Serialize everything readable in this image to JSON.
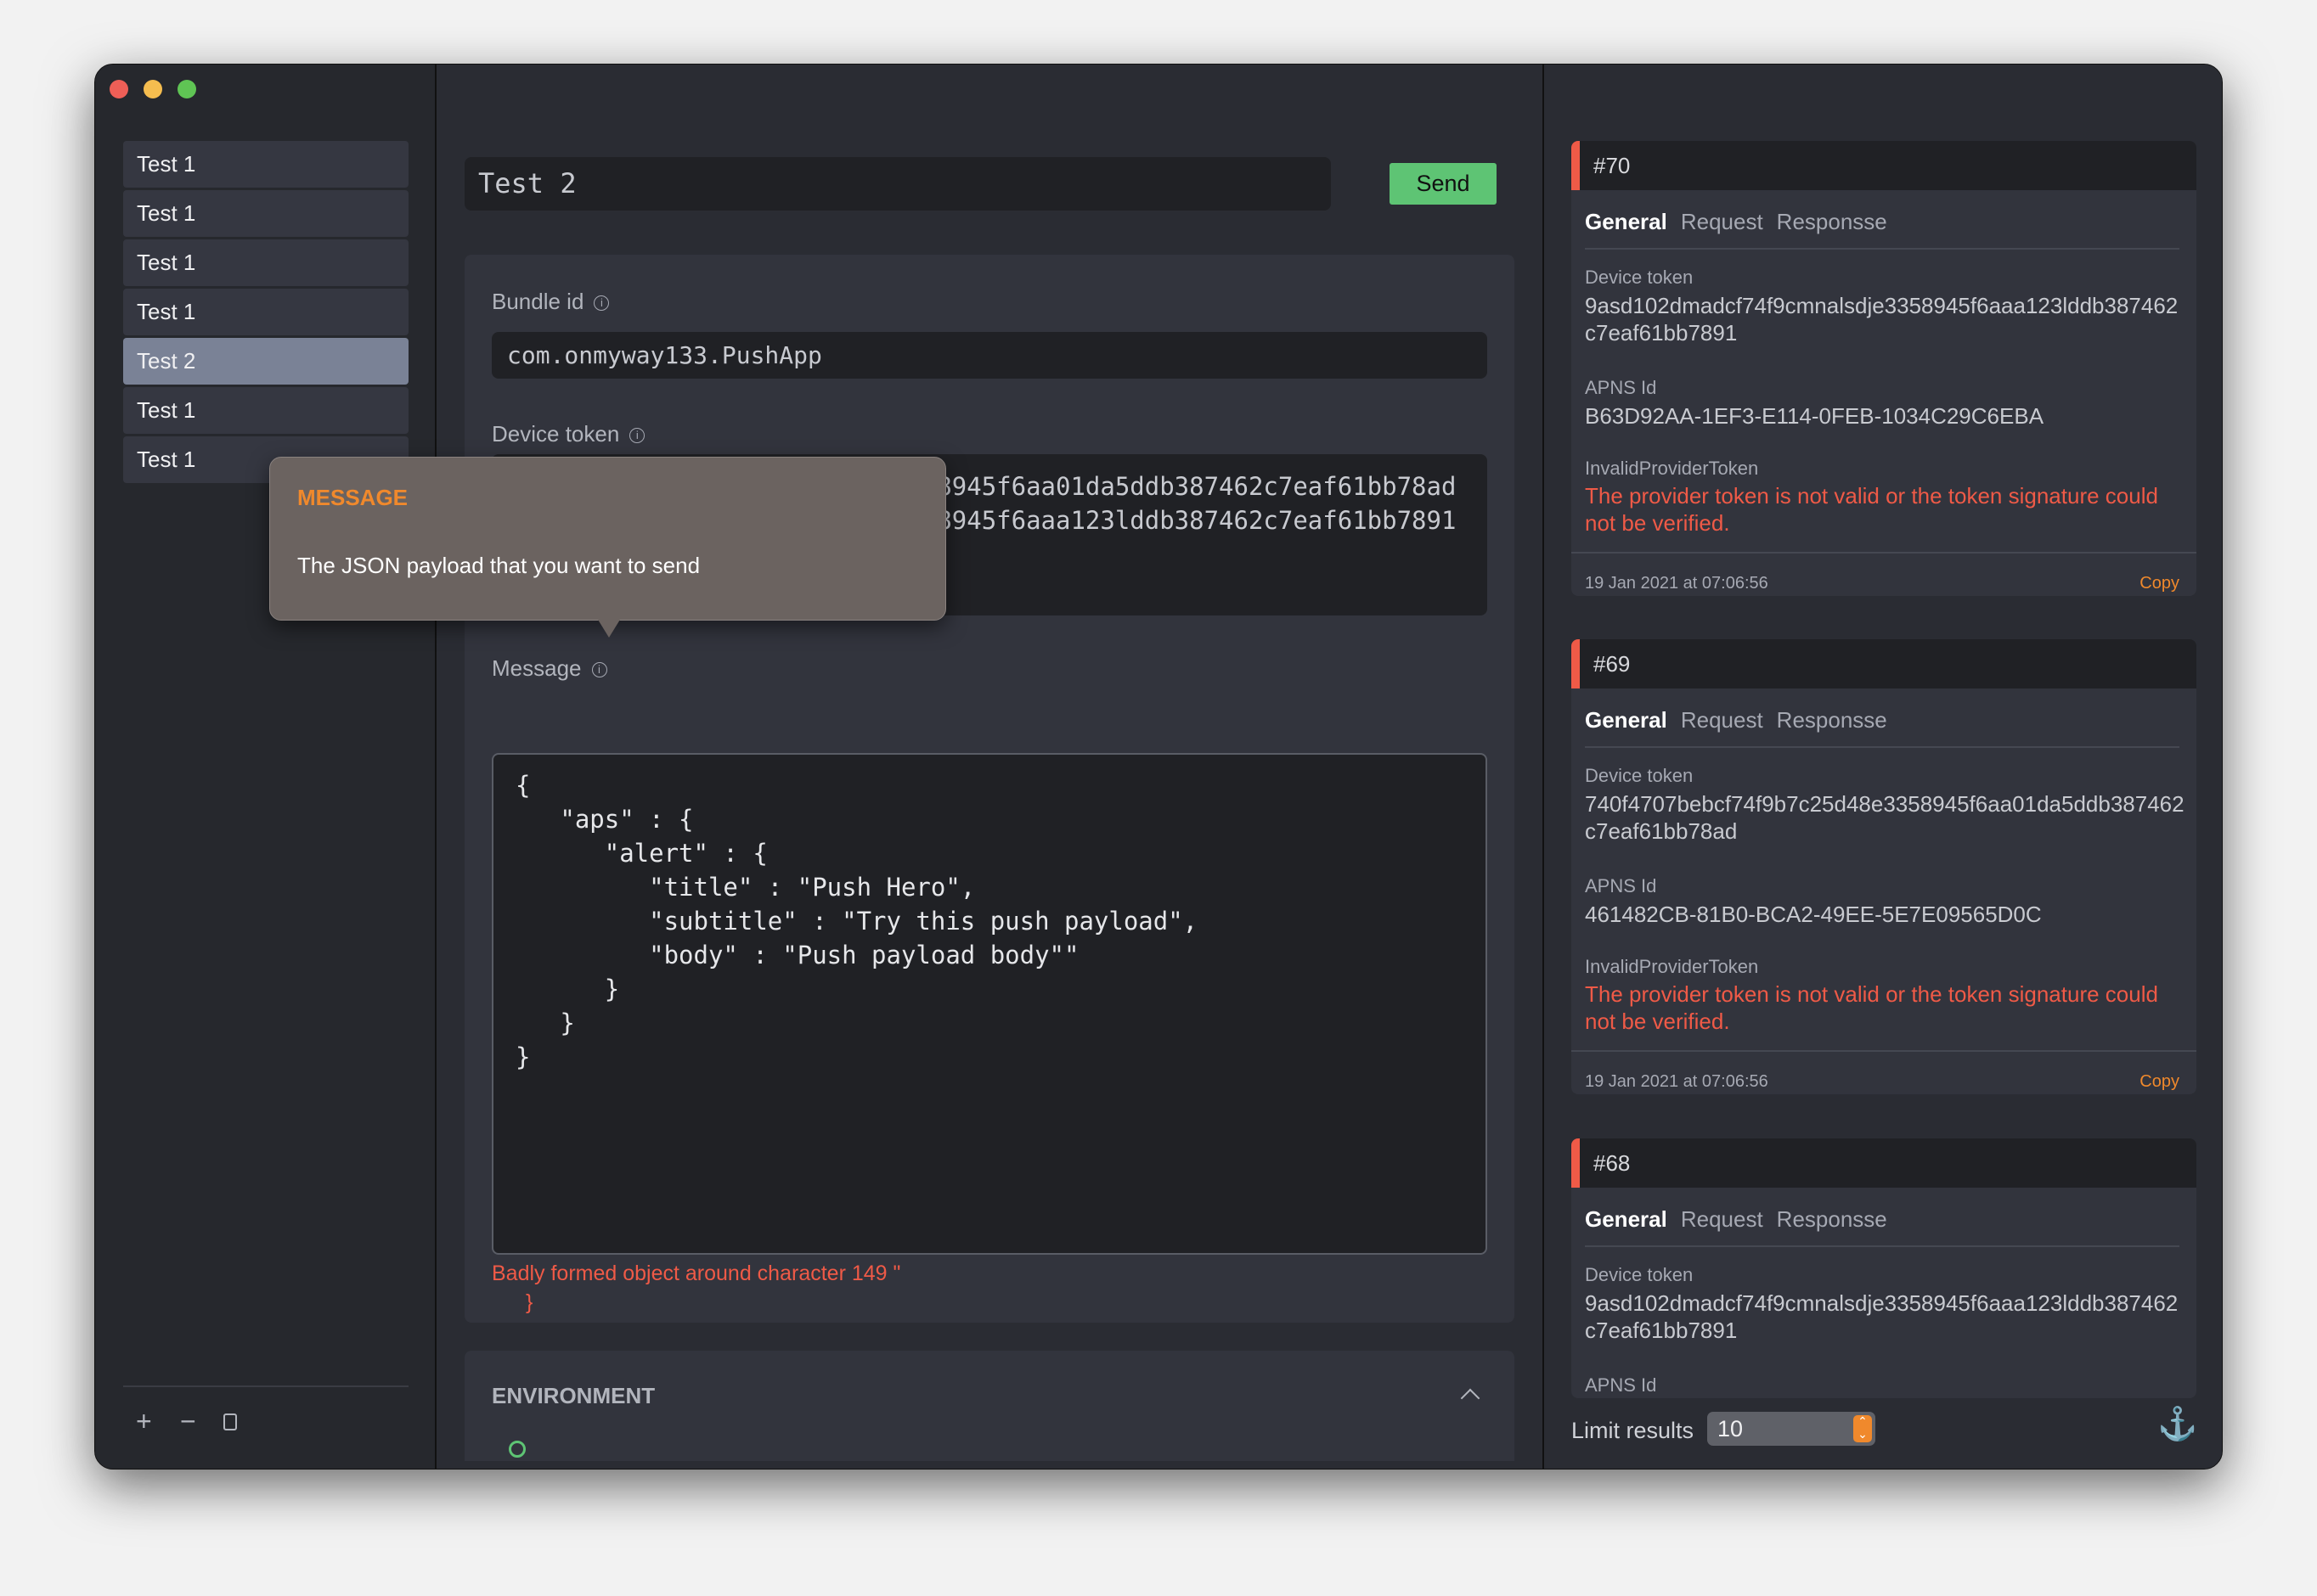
{
  "window": {
    "traffic_lights": {
      "close": "#ee5f57",
      "minimize": "#f5bd4f",
      "zoom": "#5fc454"
    }
  },
  "sidebar": {
    "items": [
      {
        "label": "Test 1"
      },
      {
        "label": "Test 1"
      },
      {
        "label": "Test 1"
      },
      {
        "label": "Test 1"
      },
      {
        "label": "Test 2",
        "selected": true
      },
      {
        "label": "Test 1"
      },
      {
        "label": "Test 1"
      }
    ],
    "footer": {
      "add_icon": "+",
      "remove_icon": "−",
      "duplicate_icon": "duplicate-icon"
    }
  },
  "editor": {
    "title_value": "Test 2",
    "send_label": "Send",
    "bundle_label": "Bundle id",
    "bundle_value": "com.onmyway133.PushApp",
    "device_label": "Device token",
    "device_tokens": [
      "740f4707bebcf74f9b7c25d48e3358945f6aa01da5ddb387462c7eaf61bb78ad",
      "9asd102dmadcf74f9cmnalsdje3358945f6aaa123lddb387462c7eaf61bb7891"
    ],
    "message_label": "Message",
    "message_value": "{\n   \"aps\" : {\n      \"alert\" : {\n         \"title\" : \"Push Hero\",\n         \"subtitle\" : \"Try this push payload\",\n         \"body\" : \"Push payload body\"\"\n      }\n   }\n}",
    "error_line1": "Badly formed object around character 149 \"",
    "error_line2": "}",
    "environment_label": "ENVIRONMENT"
  },
  "tooltip": {
    "title": "MESSAGE",
    "text": "The JSON payload that you want to send"
  },
  "results": {
    "tabs": [
      "General",
      "Request",
      "Responsse"
    ],
    "device_label": "Device token",
    "apns_label": "APNS Id",
    "copy_label": "Copy",
    "cards": [
      {
        "id": "#70",
        "device_token": "9asd102dmadcf74f9cmnalsdje3358945f6aaa123lddb387462c7eaf61bb7891",
        "apns_id": "B63D92AA-1EF3-E114-0FEB-1034C29C6EBA",
        "error_title": "InvalidProviderToken",
        "error_message": "The provider token is not valid or the token signature could not be verified.",
        "date": "19 Jan 2021 at 07:06:56"
      },
      {
        "id": "#69",
        "device_token": "740f4707bebcf74f9b7c25d48e3358945f6aa01da5ddb387462c7eaf61bb78ad",
        "apns_id": "461482CB-81B0-BCA2-49EE-5E7E09565D0C",
        "error_title": "InvalidProviderToken",
        "error_message": "The provider token is not valid or the token signature could not be verified.",
        "date": "19 Jan 2021 at 07:06:56"
      },
      {
        "id": "#68",
        "device_token": "9asd102dmadcf74f9cmnalsdje3358945f6aaa123lddb387462c7eaf61bb7891"
      }
    ],
    "limit_label": "Limit results",
    "limit_value": "10"
  },
  "colors": {
    "accent_orange": "#f0892c",
    "error_red": "#ef5a47",
    "send_green": "#5ec474"
  }
}
